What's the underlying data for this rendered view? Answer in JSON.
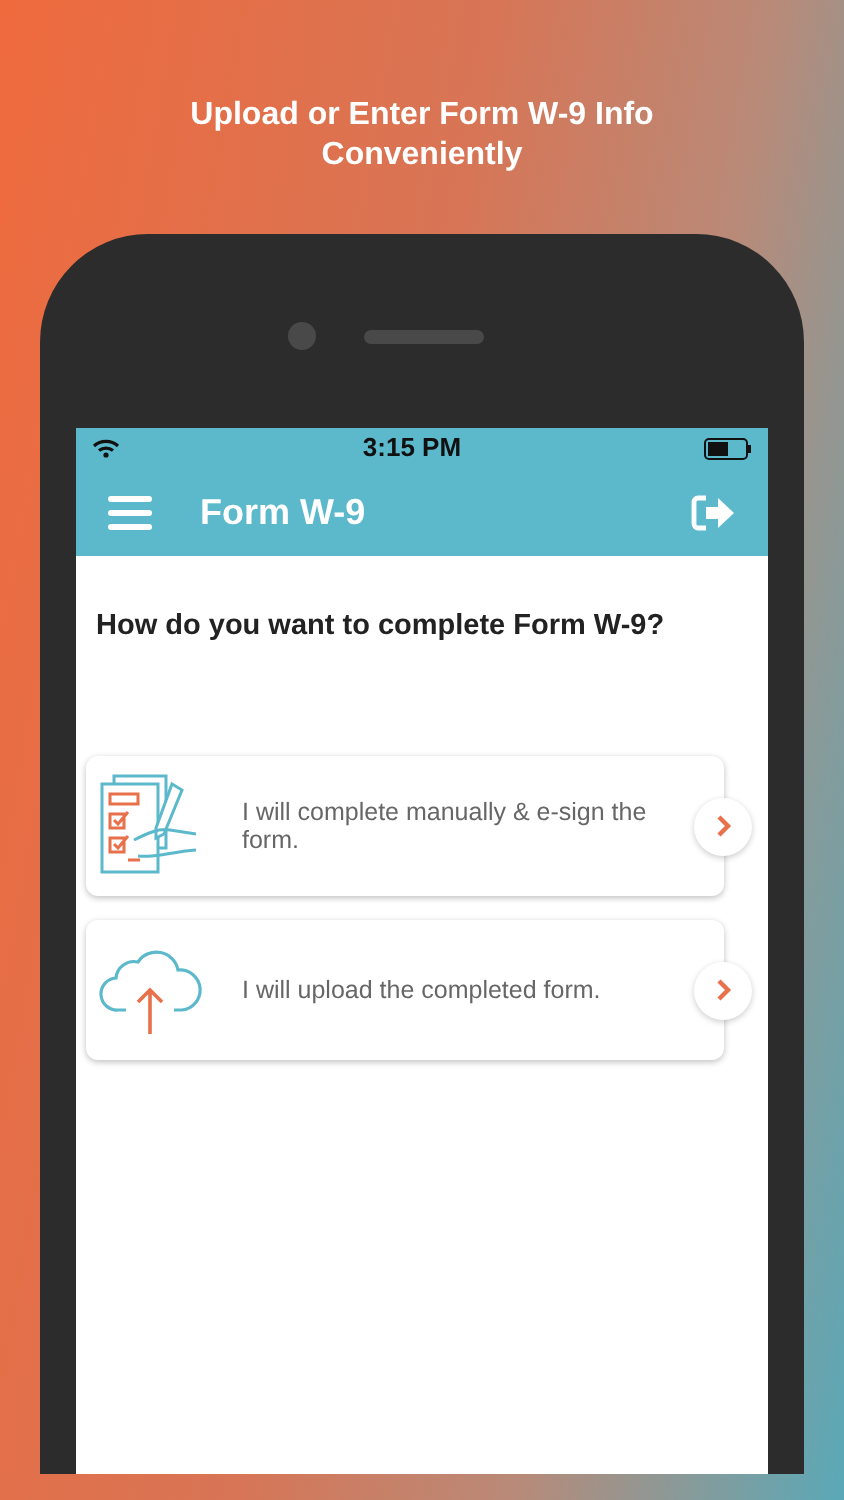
{
  "headline": "Upload or Enter Form W-9 Info Conveniently",
  "status_bar": {
    "time": "3:15 PM"
  },
  "nav_bar": {
    "title": "Form W-9"
  },
  "question": "How do you want to complete Form W-9?",
  "options": [
    {
      "kind": "manual",
      "label": "I will complete manually & e-sign the form."
    },
    {
      "kind": "upload",
      "label": "I will upload the completed form."
    }
  ]
}
